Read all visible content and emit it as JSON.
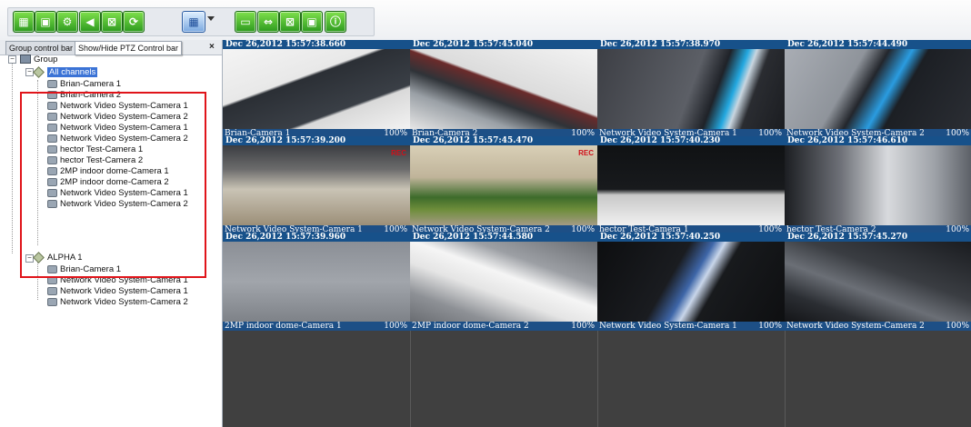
{
  "toolbar": {
    "buttons": [
      {
        "icon": "layout-icon",
        "glyph": "▦"
      },
      {
        "icon": "group-icon",
        "glyph": "▣"
      },
      {
        "icon": "settings-icon",
        "glyph": "⚙"
      },
      {
        "icon": "audio-icon",
        "glyph": "◀"
      },
      {
        "icon": "tile-icon",
        "glyph": "⊠"
      },
      {
        "icon": "refresh-icon",
        "glyph": "⟳"
      },
      {
        "icon": "grid-layout-icon",
        "glyph": "▦"
      },
      {
        "icon": "fit-window-icon",
        "glyph": "▭"
      },
      {
        "icon": "fullscreen-icon",
        "glyph": "⇔"
      },
      {
        "icon": "tile-all-icon",
        "glyph": "⊠"
      },
      {
        "icon": "snapshot-icon",
        "glyph": "▣"
      },
      {
        "icon": "info-icon",
        "glyph": "ⓘ"
      }
    ]
  },
  "left_panel": {
    "tab_group": "Group control bar",
    "tab_ptz": "Show/Hide PTZ Control bar",
    "close": "×",
    "tree": {
      "root": "Group",
      "all_channels": "All channels",
      "all_channels_items": [
        "Brian-Camera 1",
        "Brian-Camera 2",
        "Network Video System-Camera 1",
        "Network Video System-Camera 2",
        "Network Video System-Camera 1",
        "Network Video System-Camera 2",
        "hector Test-Camera 1",
        "hector Test-Camera 2",
        "2MP indoor dome-Camera 1",
        "2MP indoor dome-Camera 2",
        "Network Video System-Camera 1",
        "Network Video System-Camera 2"
      ],
      "alpha": "ALPHA 1",
      "alpha_items": [
        "Brian-Camera 1",
        "Network Video System-Camera 1",
        "Network Video System-Camera 1",
        "Network Video System-Camera 2"
      ]
    }
  },
  "grid": {
    "rec_label": "REC",
    "cells": [
      {
        "timestamp": "Dec 26,2012 15:57:38.660",
        "name": "Brian-Camera 1",
        "percent": "100%",
        "rec": false,
        "scene": "a"
      },
      {
        "timestamp": "Dec 26,2012 15:57:45.040",
        "name": "Brian-Camera 2",
        "percent": "100%",
        "rec": false,
        "scene": "b"
      },
      {
        "timestamp": "Dec 26,2012 15:57:38.970",
        "name": "Network Video System-Camera 1",
        "percent": "100%",
        "rec": false,
        "scene": "c"
      },
      {
        "timestamp": "Dec 26,2012 15:57:44.490",
        "name": "Network Video System-Camera 2",
        "percent": "100%",
        "rec": false,
        "scene": "d"
      },
      {
        "timestamp": "Dec 26,2012 15:57:39.200",
        "name": "Network Video System-Camera 1",
        "percent": "100%",
        "rec": true,
        "scene": "e"
      },
      {
        "timestamp": "Dec 26,2012 15:57:45.470",
        "name": "Network Video System-Camera 2",
        "percent": "100%",
        "rec": true,
        "scene": "f"
      },
      {
        "timestamp": "Dec 26,2012 15:57:40.230",
        "name": "hector Test-Camera 1",
        "percent": "100%",
        "rec": false,
        "scene": "g"
      },
      {
        "timestamp": "Dec 26,2012 15:57:46.610",
        "name": "hector Test-Camera 2",
        "percent": "100%",
        "rec": false,
        "scene": "h"
      },
      {
        "timestamp": "Dec 26,2012 15:57:39.960",
        "name": "2MP indoor dome-Camera 1",
        "percent": "100%",
        "rec": false,
        "scene": "i"
      },
      {
        "timestamp": "Dec 26,2012 15:57:44.580",
        "name": "2MP indoor dome-Camera 2",
        "percent": "100%",
        "rec": false,
        "scene": "j"
      },
      {
        "timestamp": "Dec 26,2012 15:57:40.250",
        "name": "Network Video System-Camera 1",
        "percent": "100%",
        "rec": false,
        "scene": "k"
      },
      {
        "timestamp": "Dec 26,2012 15:57:45.270",
        "name": "Network Video System-Camera 2",
        "percent": "100%",
        "rec": false,
        "scene": "l"
      }
    ]
  }
}
